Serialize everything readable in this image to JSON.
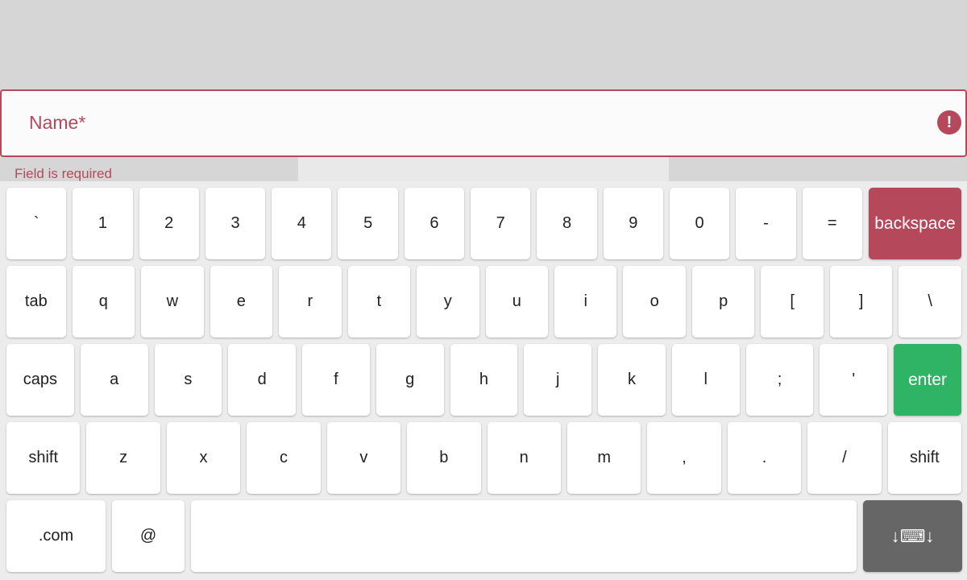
{
  "field": {
    "label": "Name*",
    "value": "",
    "error_icon": "!",
    "helper_text": "Field is required"
  },
  "keyboard": {
    "rows": [
      [
        "`",
        "1",
        "2",
        "3",
        "4",
        "5",
        "6",
        "7",
        "8",
        "9",
        "0",
        "-",
        "=",
        "backspace"
      ],
      [
        "tab",
        "q",
        "w",
        "e",
        "r",
        "t",
        "y",
        "u",
        "i",
        "o",
        "p",
        "[",
        "]",
        "\\"
      ],
      [
        "caps",
        "a",
        "s",
        "d",
        "f",
        "g",
        "h",
        "j",
        "k",
        "l",
        ";",
        "'",
        "enter"
      ],
      [
        "shift",
        "z",
        "x",
        "c",
        "v",
        "b",
        "n",
        "m",
        ",",
        ".",
        "/",
        "shift"
      ],
      [
        ".com",
        "@",
        "",
        "↓⌨↓"
      ]
    ]
  },
  "colors": {
    "error": "#b5495b",
    "enter": "#2fb364",
    "hide_key": "#666666"
  }
}
